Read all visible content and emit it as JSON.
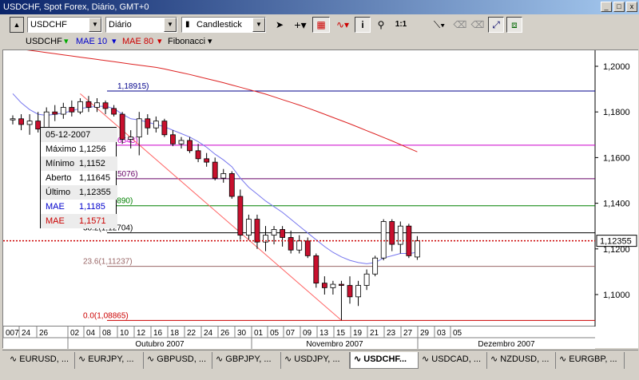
{
  "window": {
    "title": "USDCHF, Spot Forex, Diário, GMT+0",
    "controls": [
      "_",
      "□",
      "x"
    ]
  },
  "toolbar": {
    "symbol": "USDCHF",
    "timeframe": "Diário",
    "chart_type": "Candlestick",
    "zoom_label": "1:1"
  },
  "legend": {
    "symbol": "USDCHF",
    "ma1": "MAE 10",
    "ma2": "MAE 80",
    "fib": "Fibonacci",
    "colors": {
      "ma1": "#0000cc",
      "ma2": "#cc0000",
      "fib": "#000000"
    }
  },
  "tooltip": {
    "date": "05-12-2007",
    "rows": [
      {
        "label": "Máximo",
        "value": "1,1256"
      },
      {
        "label": "Mínimo",
        "value": "1,1152"
      },
      {
        "label": "Aberto",
        "value": "1,11645"
      },
      {
        "label": "Último",
        "value": "1,12355"
      },
      {
        "label": "MAE",
        "value": "1,1185",
        "color": "#0000cc"
      },
      {
        "label": "MAE",
        "value": "1,1571",
        "color": "#cc0000"
      }
    ]
  },
  "fib_levels": [
    {
      "label": "1,18915)",
      "value": 1.18915,
      "color": "#00008b",
      "partial": true
    },
    {
      "label": "6543)",
      "value": 1.16543,
      "color": "#cc00cc",
      "partial": true
    },
    {
      "label": "5076)",
      "value": 1.15076,
      "color": "#660066",
      "partial": true
    },
    {
      "label": "50.0(1,13890)",
      "value": 1.1389,
      "color": "#008000"
    },
    {
      "label": "38.2(1,12704)",
      "value": 1.12704,
      "color": "#000000"
    },
    {
      "label": "23.6(1,11237)",
      "value": 1.11237,
      "color": "#996666"
    },
    {
      "label": "0.0(1,08865)",
      "value": 1.08865,
      "color": "#cc0000"
    }
  ],
  "current_price": {
    "label": "1,12355",
    "value": 1.12355
  },
  "chart_data": {
    "type": "candlestick",
    "title": "",
    "ylim": [
      1.086,
      1.207
    ],
    "y_ticks": [
      {
        "label": "1,2000",
        "value": 1.2
      },
      {
        "label": "1,1800",
        "value": 1.18
      },
      {
        "label": "1,1600",
        "value": 1.16
      },
      {
        "label": "1,1400",
        "value": 1.14
      },
      {
        "label": "1,1200",
        "value": 1.12
      },
      {
        "label": "1,1000",
        "value": 1.1
      }
    ],
    "x_ticks": [
      "007",
      "24",
      "26",
      "02",
      "04",
      "08",
      "10",
      "12",
      "16",
      "18",
      "22",
      "24",
      "26",
      "30",
      "01",
      "05",
      "07",
      "09",
      "13",
      "15",
      "19",
      "21",
      "23",
      "27",
      "29",
      "03",
      "05"
    ],
    "months": [
      "Outubro 2007",
      "Novembro 2007",
      "Dezembro 2007"
    ],
    "candles": [
      {
        "o": 1.1765,
        "h": 1.1785,
        "l": 1.1745,
        "c": 1.177
      },
      {
        "o": 1.177,
        "h": 1.179,
        "l": 1.172,
        "c": 1.1745
      },
      {
        "o": 1.1745,
        "h": 1.179,
        "l": 1.17,
        "c": 1.176
      },
      {
        "o": 1.176,
        "h": 1.18,
        "l": 1.171,
        "c": 1.1725
      },
      {
        "o": 1.1725,
        "h": 1.182,
        "l": 1.1715,
        "c": 1.18
      },
      {
        "o": 1.18,
        "h": 1.183,
        "l": 1.176,
        "c": 1.179
      },
      {
        "o": 1.179,
        "h": 1.184,
        "l": 1.177,
        "c": 1.182
      },
      {
        "o": 1.182,
        "h": 1.185,
        "l": 1.178,
        "c": 1.18
      },
      {
        "o": 1.18,
        "h": 1.186,
        "l": 1.179,
        "c": 1.1845
      },
      {
        "o": 1.1845,
        "h": 1.187,
        "l": 1.18,
        "c": 1.182
      },
      {
        "o": 1.182,
        "h": 1.186,
        "l": 1.18,
        "c": 1.184
      },
      {
        "o": 1.184,
        "h": 1.185,
        "l": 1.179,
        "c": 1.1815
      },
      {
        "o": 1.1815,
        "h": 1.183,
        "l": 1.178,
        "c": 1.179
      },
      {
        "o": 1.179,
        "h": 1.18,
        "l": 1.166,
        "c": 1.168
      },
      {
        "o": 1.168,
        "h": 1.172,
        "l": 1.164,
        "c": 1.169
      },
      {
        "o": 1.169,
        "h": 1.18,
        "l": 1.161,
        "c": 1.177
      },
      {
        "o": 1.177,
        "h": 1.179,
        "l": 1.17,
        "c": 1.173
      },
      {
        "o": 1.173,
        "h": 1.178,
        "l": 1.171,
        "c": 1.176
      },
      {
        "o": 1.176,
        "h": 1.177,
        "l": 1.169,
        "c": 1.17
      },
      {
        "o": 1.17,
        "h": 1.172,
        "l": 1.165,
        "c": 1.166
      },
      {
        "o": 1.166,
        "h": 1.169,
        "l": 1.164,
        "c": 1.1675
      },
      {
        "o": 1.1675,
        "h": 1.169,
        "l": 1.162,
        "c": 1.163
      },
      {
        "o": 1.163,
        "h": 1.166,
        "l": 1.158,
        "c": 1.1595
      },
      {
        "o": 1.1595,
        "h": 1.162,
        "l": 1.156,
        "c": 1.158
      },
      {
        "o": 1.158,
        "h": 1.16,
        "l": 1.15,
        "c": 1.151
      },
      {
        "o": 1.151,
        "h": 1.155,
        "l": 1.149,
        "c": 1.153
      },
      {
        "o": 1.153,
        "h": 1.154,
        "l": 1.142,
        "c": 1.143
      },
      {
        "o": 1.143,
        "h": 1.146,
        "l": 1.124,
        "c": 1.126
      },
      {
        "o": 1.126,
        "h": 1.135,
        "l": 1.124,
        "c": 1.133
      },
      {
        "o": 1.133,
        "h": 1.135,
        "l": 1.12,
        "c": 1.123
      },
      {
        "o": 1.123,
        "h": 1.13,
        "l": 1.119,
        "c": 1.126
      },
      {
        "o": 1.126,
        "h": 1.13,
        "l": 1.122,
        "c": 1.1285
      },
      {
        "o": 1.1285,
        "h": 1.13,
        "l": 1.121,
        "c": 1.125
      },
      {
        "o": 1.125,
        "h": 1.128,
        "l": 1.118,
        "c": 1.1195
      },
      {
        "o": 1.1195,
        "h": 1.126,
        "l": 1.118,
        "c": 1.1235
      },
      {
        "o": 1.1235,
        "h": 1.125,
        "l": 1.116,
        "c": 1.117
      },
      {
        "o": 1.117,
        "h": 1.118,
        "l": 1.103,
        "c": 1.105
      },
      {
        "o": 1.105,
        "h": 1.108,
        "l": 1.1,
        "c": 1.103
      },
      {
        "o": 1.103,
        "h": 1.106,
        "l": 1.1,
        "c": 1.1045
      },
      {
        "o": 1.1045,
        "h": 1.106,
        "l": 1.0887,
        "c": 1.104
      },
      {
        "o": 1.104,
        "h": 1.108,
        "l": 1.096,
        "c": 1.099
      },
      {
        "o": 1.099,
        "h": 1.106,
        "l": 1.095,
        "c": 1.104
      },
      {
        "o": 1.104,
        "h": 1.111,
        "l": 1.102,
        "c": 1.109
      },
      {
        "o": 1.109,
        "h": 1.117,
        "l": 1.108,
        "c": 1.116
      },
      {
        "o": 1.116,
        "h": 1.133,
        "l": 1.115,
        "c": 1.132
      },
      {
        "o": 1.132,
        "h": 1.133,
        "l": 1.119,
        "c": 1.122
      },
      {
        "o": 1.122,
        "h": 1.132,
        "l": 1.118,
        "c": 1.13
      },
      {
        "o": 1.13,
        "h": 1.131,
        "l": 1.116,
        "c": 1.117
      },
      {
        "o": 1.11645,
        "h": 1.1256,
        "l": 1.1152,
        "c": 1.12355
      }
    ],
    "mae10": [
      1.188,
      1.184,
      1.181,
      1.179,
      1.1785,
      1.179,
      1.1795,
      1.1805,
      1.1815,
      1.182,
      1.1825,
      1.1825,
      1.1815,
      1.179,
      1.177,
      1.1765,
      1.1755,
      1.1745,
      1.1735,
      1.172,
      1.1705,
      1.169,
      1.167,
      1.1645,
      1.1615,
      1.159,
      1.156,
      1.151,
      1.147,
      1.144,
      1.141,
      1.1385,
      1.136,
      1.133,
      1.13,
      1.127,
      1.124,
      1.121,
      1.1185,
      1.1165,
      1.115,
      1.114,
      1.1135,
      1.114,
      1.116,
      1.117,
      1.118,
      1.118,
      1.1185
    ],
    "mae80": [
      1.208,
      1.2075,
      1.207,
      1.2065,
      1.206,
      1.2055,
      1.205,
      1.2045,
      1.204,
      1.2035,
      1.203,
      1.2025,
      1.202,
      1.2015,
      1.201,
      1.2005,
      1.2,
      1.1995,
      1.1988,
      1.198,
      1.1972,
      1.1964,
      1.1955,
      1.1946,
      1.1937,
      1.1928,
      1.1918,
      1.1908,
      1.1898,
      1.1888,
      1.1878,
      1.1866,
      1.1854,
      1.1842,
      1.183,
      1.1817,
      1.1804,
      1.179,
      1.1776,
      1.1762,
      1.1748,
      1.1733,
      1.1718,
      1.1703,
      1.1688,
      1.1673,
      1.1657,
      1.1641,
      1.1625
    ]
  },
  "tabs": [
    {
      "label": "EURUSD, ..."
    },
    {
      "label": "EURJPY, ..."
    },
    {
      "label": "GBPUSD, ..."
    },
    {
      "label": "GBPJPY, ..."
    },
    {
      "label": "USDJPY, ..."
    },
    {
      "label": "USDCHF...",
      "active": true
    },
    {
      "label": "USDCAD, ..."
    },
    {
      "label": "NZDUSD, ..."
    },
    {
      "label": "EURGBP, ..."
    }
  ]
}
